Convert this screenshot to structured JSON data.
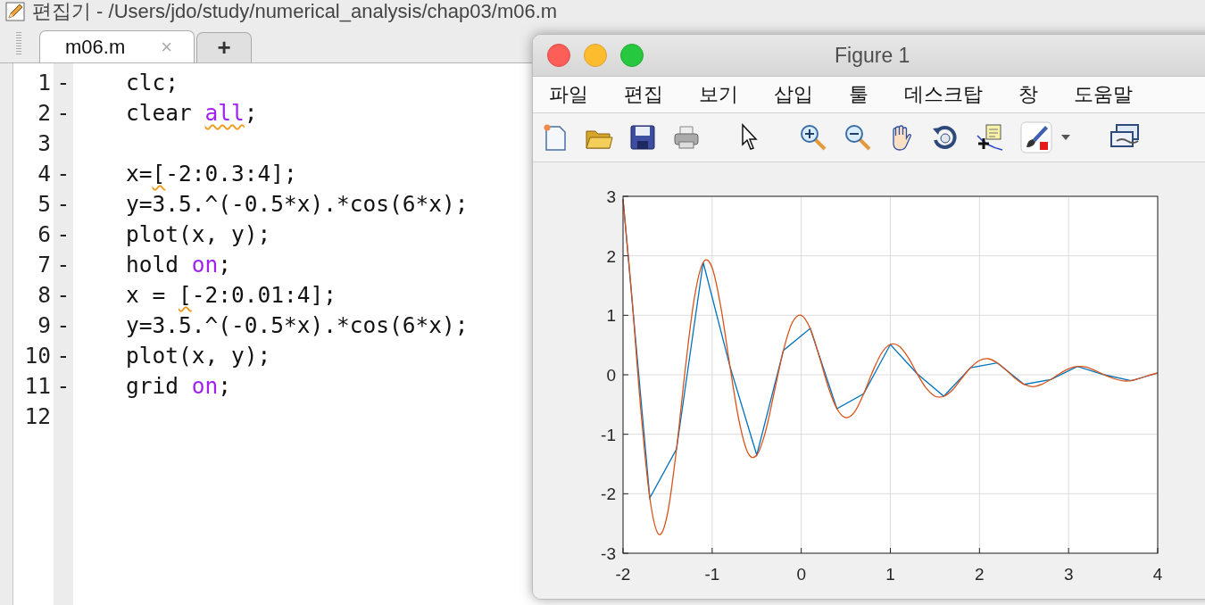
{
  "editor": {
    "title": "편집기 - /Users/jdo/study/numerical_analysis/chap03/m06.m",
    "tabs": [
      {
        "label": "m06.m",
        "selected": true,
        "close": "×"
      },
      {
        "label": "+",
        "selected": false
      }
    ],
    "lines": [
      {
        "number": "1",
        "marker": "-",
        "segments": [
          {
            "text": "clc;",
            "kind": "code",
            "warning": false
          }
        ]
      },
      {
        "number": "2",
        "marker": "-",
        "segments": [
          {
            "text": "clear ",
            "kind": "code",
            "warning": false
          },
          {
            "text": "all",
            "kind": "keyword",
            "warning": true
          },
          {
            "text": ";",
            "kind": "code",
            "warning": false
          }
        ]
      },
      {
        "number": "3"
      },
      {
        "number": "4",
        "marker": "-",
        "segments": [
          {
            "text": "x=",
            "kind": "code",
            "warning": false
          },
          {
            "text": "[",
            "kind": "code",
            "warning": true
          },
          {
            "text": "-2:0.3:4];",
            "kind": "code",
            "warning": false
          }
        ]
      },
      {
        "number": "5",
        "marker": "-",
        "segments": [
          {
            "text": "y=3.5.^(-0.5*x).*cos(6*x);",
            "kind": "code",
            "warning": false
          }
        ]
      },
      {
        "number": "6",
        "marker": "-",
        "segments": [
          {
            "text": "plot(x, y);",
            "kind": "code",
            "warning": false
          }
        ]
      },
      {
        "number": "7",
        "marker": "-",
        "segments": [
          {
            "text": "hold ",
            "kind": "code",
            "warning": false
          },
          {
            "text": "on",
            "kind": "keyword",
            "warning": false
          },
          {
            "text": ";",
            "kind": "code",
            "warning": false
          }
        ]
      },
      {
        "number": "8",
        "marker": "-",
        "segments": [
          {
            "text": "x = ",
            "kind": "code",
            "warning": false
          },
          {
            "text": "[",
            "kind": "code",
            "warning": true
          },
          {
            "text": "-2:0.01:4];",
            "kind": "code",
            "warning": false
          }
        ]
      },
      {
        "number": "9",
        "marker": "-",
        "segments": [
          {
            "text": "y=3.5.^(-0.5*x).*cos(6*x);",
            "kind": "code",
            "warning": false
          }
        ]
      },
      {
        "number": "10",
        "marker": "-",
        "segments": [
          {
            "text": "plot(x, y);",
            "kind": "code",
            "warning": false
          }
        ]
      },
      {
        "number": "11",
        "marker": "-",
        "segments": [
          {
            "text": "grid ",
            "kind": "code",
            "warning": false
          },
          {
            "text": "on",
            "kind": "keyword",
            "warning": false
          },
          {
            "text": ";",
            "kind": "code",
            "warning": false
          }
        ]
      },
      {
        "number": "12"
      }
    ]
  },
  "figure": {
    "title": "Figure 1",
    "menu": [
      "파일",
      "편집",
      "보기",
      "삽입",
      "툴",
      "데스크탑",
      "창",
      "도움말"
    ],
    "chart_data": {
      "type": "line",
      "xlim": [
        -2,
        4
      ],
      "ylim": [
        -3,
        3
      ],
      "xticks": [
        -2,
        -1,
        0,
        1,
        2,
        3,
        4
      ],
      "yticks": [
        -3,
        -2,
        -1,
        0,
        1,
        2,
        3
      ],
      "grid": true,
      "series": [
        {
          "color": "#0072bd",
          "x": [
            -2,
            -1.7,
            -1.4,
            -1.1,
            -0.8,
            -0.5,
            -0.2,
            0.1,
            0.4,
            0.7,
            1.0,
            1.3,
            1.6,
            1.9,
            2.2,
            2.5,
            2.8,
            3.1,
            3.4,
            3.7,
            4.0
          ],
          "values": [
            2.95,
            -2.07,
            -1.25,
            1.89,
            0.14,
            -1.35,
            0.41,
            0.78,
            -0.57,
            -0.32,
            0.51,
            0.02,
            -0.36,
            0.12,
            0.2,
            -0.16,
            -0.08,
            0.14,
            0.0,
            -0.1,
            0.03
          ]
        },
        {
          "color": "#d95319",
          "x": [
            -2,
            -1.9,
            -1.8,
            -1.7,
            -1.6,
            -1.5,
            -1.4,
            -1.3,
            -1.2,
            -1.1,
            -1,
            -0.9,
            -0.8,
            -0.7,
            -0.6,
            -0.5,
            -0.4,
            -0.3,
            -0.2,
            -0.1,
            0,
            0.1,
            0.2,
            0.3,
            0.4,
            0.5,
            0.6,
            0.7,
            0.8,
            0.9,
            1,
            1.1,
            1.2,
            1.3,
            1.4,
            1.5,
            1.6,
            1.7,
            1.8,
            1.9,
            2,
            2.1,
            2.2,
            2.3,
            2.4,
            2.5,
            2.6,
            2.7,
            2.8,
            2.9,
            3,
            3.1,
            3.2,
            3.3,
            3.4,
            3.5,
            3.6,
            3.7,
            3.8,
            3.9,
            4
          ],
          "values": [
            2.95,
            1.29,
            -0.6,
            -2.07,
            -2.68,
            -2.33,
            -1.25,
            0.12,
            1.29,
            1.89,
            1.8,
            1.12,
            0.14,
            -0.76,
            -1.31,
            -1.35,
            -0.95,
            -0.27,
            0.41,
            0.88,
            1.0,
            0.78,
            0.32,
            -0.19,
            -0.57,
            -0.72,
            -0.62,
            -0.32,
            0.05,
            0.36,
            0.51,
            0.48,
            0.29,
            0.02,
            -0.22,
            -0.36,
            -0.36,
            -0.25,
            -0.06,
            0.12,
            0.24,
            0.27,
            0.2,
            0.08,
            -0.06,
            -0.16,
            -0.2,
            -0.16,
            -0.08,
            0.02,
            0.1,
            0.14,
            0.13,
            0.07,
            0.0,
            -0.06,
            -0.1,
            -0.1,
            -0.06,
            -0.01,
            0.03
          ]
        }
      ]
    }
  }
}
